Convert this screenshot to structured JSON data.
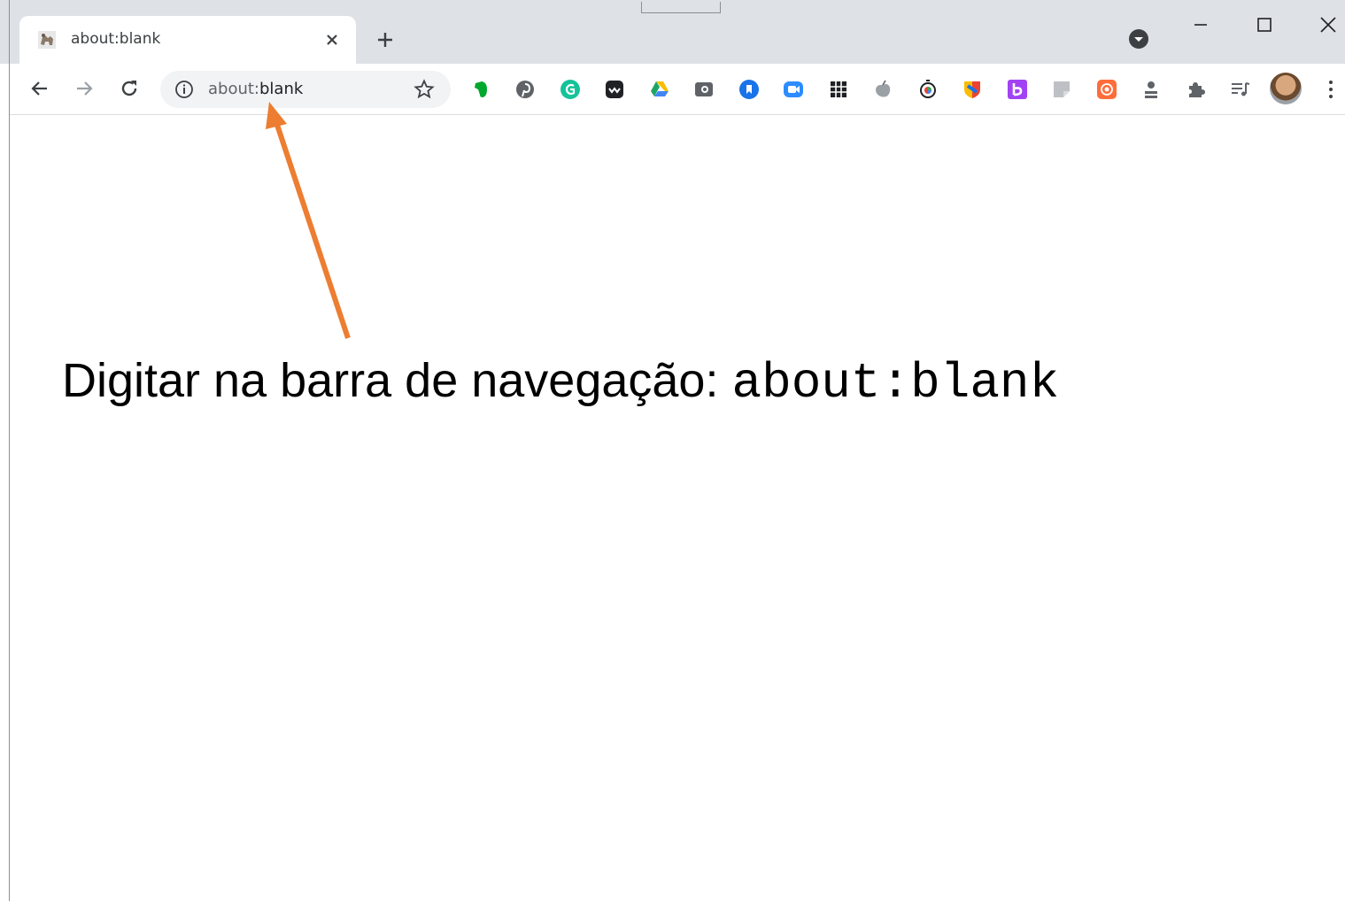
{
  "browser": {
    "tab": {
      "title": "about:blank",
      "favicon": "horse-favicon-icon",
      "close_icon": "close-icon"
    },
    "new_tab_icon": "plus-icon",
    "window_controls": [
      "minimize-icon",
      "maximize-icon",
      "close-icon"
    ],
    "omnibox": {
      "url_prefix": "about:",
      "url_host": "blank",
      "info_icon": "info-icon",
      "bookmark_icon": "star-icon"
    },
    "nav": [
      "back-arrow-icon",
      "forward-arrow-icon",
      "reload-icon"
    ],
    "extensions": [
      {
        "name": "evernote-icon",
        "color": "#00a82d"
      },
      {
        "name": "pinterest-icon",
        "color": "#5f6368"
      },
      {
        "name": "grammarly-icon",
        "color": "#15c39a"
      },
      {
        "name": "wakatime-icon",
        "color": "#202124"
      },
      {
        "name": "google-drive-icon",
        "color": "#1fa463"
      },
      {
        "name": "screencast-icon",
        "color": "#5f6368"
      },
      {
        "name": "bookmark-blue-icon",
        "color": "#1a73e8"
      },
      {
        "name": "zoom-icon",
        "color": "#2d8cff"
      },
      {
        "name": "grid-icon",
        "color": "#202124"
      },
      {
        "name": "apple-icon",
        "color": "#9aa0a6"
      },
      {
        "name": "timer-icon",
        "color": "#202124"
      },
      {
        "name": "shield-color-icon",
        "color": "#fbbc04"
      },
      {
        "name": "bitly-icon",
        "color": "#a142f4"
      },
      {
        "name": "notes-icon",
        "color": "#bdc1c6"
      },
      {
        "name": "orange-ext-icon",
        "color": "#ff6d3a"
      },
      {
        "name": "person-stack-icon",
        "color": "#5f6368"
      },
      {
        "name": "puzzle-icon",
        "color": "#5f6368"
      },
      {
        "name": "media-control-icon",
        "color": "#5f6368"
      }
    ],
    "profile_avatar": "avatar",
    "menu_icon": "kebab-menu-icon"
  },
  "annotation": {
    "text": "Digitar na barra de navegação: ",
    "code": "about:blank",
    "arrow_color": "#ed7d31"
  }
}
